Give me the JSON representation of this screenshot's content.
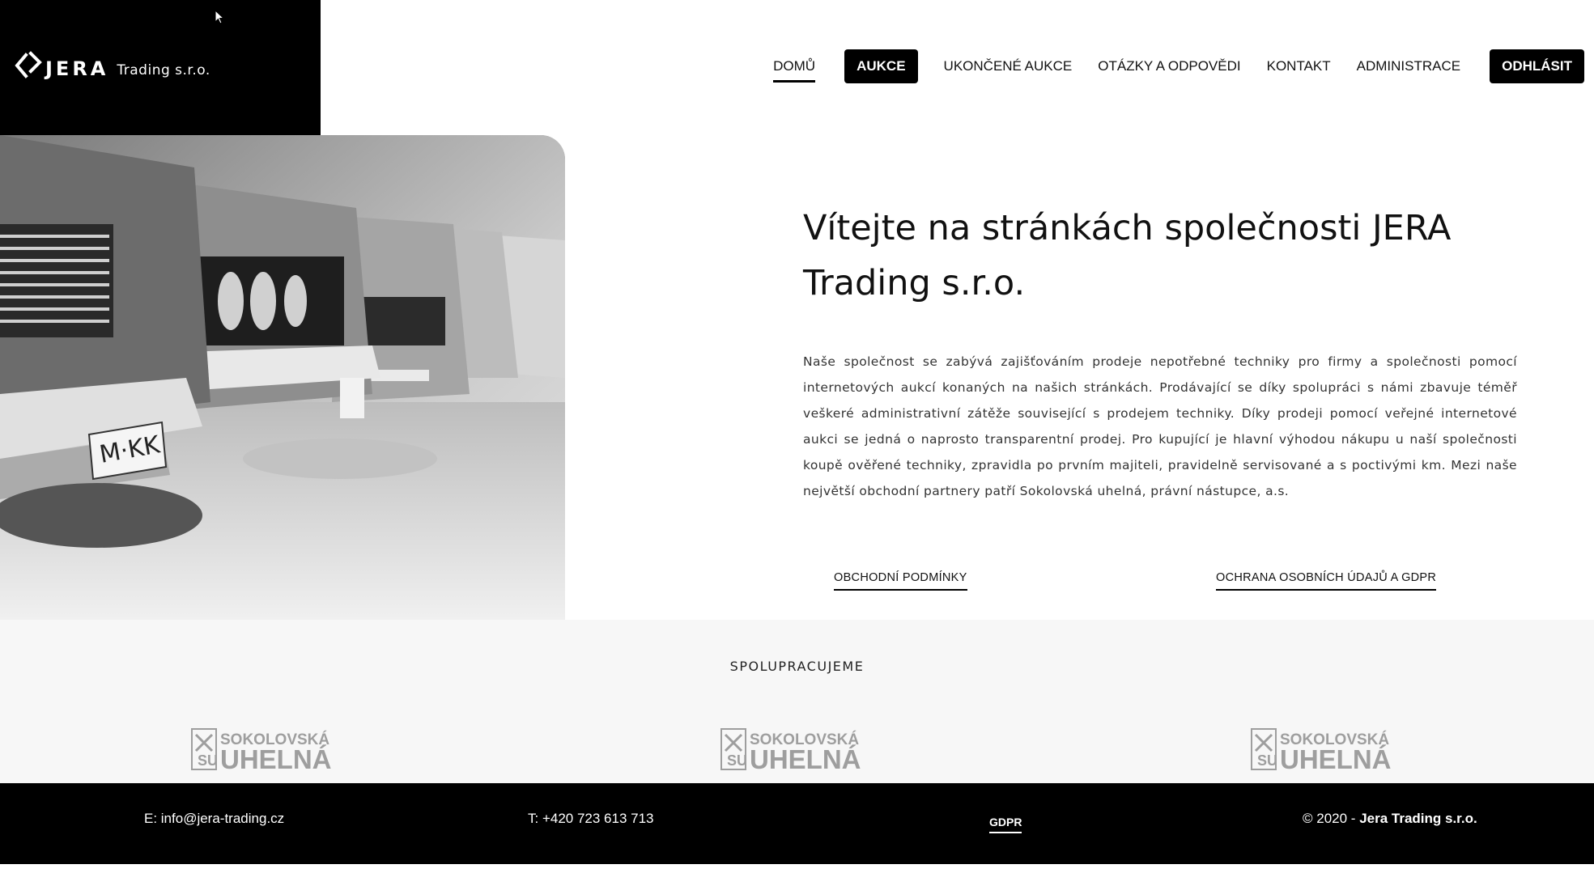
{
  "header": {
    "logo_name": "JERA",
    "logo_subtitle": "Trading s.r.o.",
    "nav": {
      "home": "DOMŮ",
      "auctions": "AUKCE",
      "finished_auctions": "UKONČENÉ AUKCE",
      "faq": "OTÁZKY A ODPOVĚDI",
      "contact": "KONTAKT",
      "admin": "ADMINISTRACE",
      "logout": "ODHLÁSIT"
    }
  },
  "hero": {
    "title": "Vítejte na stránkách společnosti JERA Trading s.r.o.",
    "text": "Naše společnost se zabývá zajišťováním prodeje nepotřebné techniky pro firmy a společnosti pomocí internetových aukcí konaných na našich stránkách. Prodávající se díky spolupráci s námi zbavuje téměř veškeré administrativní zátěže související s prodejem techniky. Díky prodeji pomocí veřejné internetové aukci se jedná o naprosto transparentní prodej. Pro kupující je hlavní výhodou nákupu u naší společnosti koupě ověřené techniky, zpravidla po prvním majiteli, pravidelně servisované a s poctivými km. Mezi naše největší obchodní partnery patří Sokolovská uhelná, právní nástupce, a.s.",
    "terms_link": "OBCHODNÍ PODMÍNKY",
    "gdpr_link": "OCHRANA OSOBNÍCH ÚDAJŮ A GDPR"
  },
  "partners": {
    "title": "SPOLUPRACUJEME",
    "logo_text_top": "SOKOLOVSKÁ",
    "logo_text_bottom": "UHELNÁ"
  },
  "footer": {
    "email": "E: info@jera-trading.cz",
    "phone": "T: +420 723 613 713",
    "gdpr": "GDPR",
    "copyright_prefix": "© 2020 - ",
    "copyright_company": "Jera Trading s.r.o."
  },
  "colors": {
    "black": "#000000",
    "partners_bg": "#f7f7f7",
    "logo_gray": "#9e9e9e"
  },
  "icons": {
    "logo": "jera-logo-icon",
    "cursor": "mouse-cursor-icon"
  }
}
